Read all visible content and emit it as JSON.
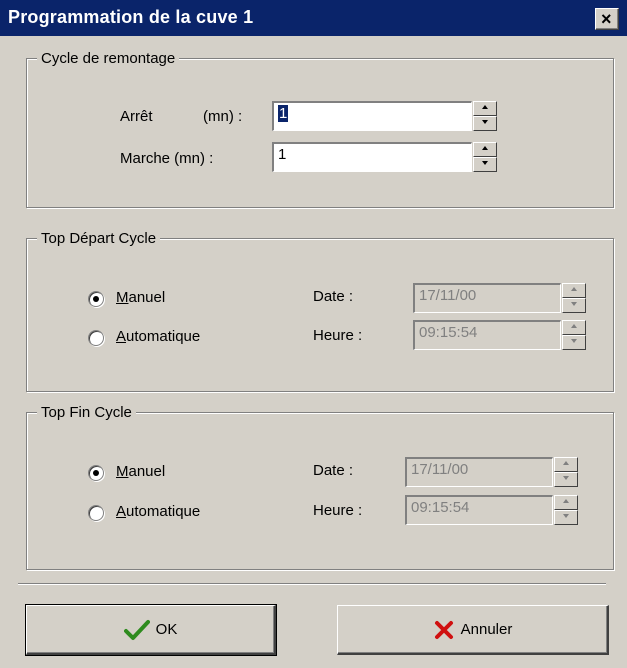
{
  "window": {
    "title": "Programmation de la cuve 1",
    "close_glyph": "×"
  },
  "cycle_remontage": {
    "legend": "Cycle de remontage",
    "arret_label": "Arrêt",
    "arret_unit": "(mn) :",
    "arret_value": "1",
    "marche_label": "Marche (mn) :",
    "marche_value": "1"
  },
  "top_depart": {
    "legend": "Top Départ Cycle",
    "manuel_label_u": "M",
    "manuel_label_rest": "anuel",
    "auto_label_u": "A",
    "auto_label_rest": "utomatique",
    "selected": "manuel",
    "date_label": "Date :",
    "date_value": "17/11/00",
    "heure_label": "Heure :",
    "heure_value": "09:15:54"
  },
  "top_fin": {
    "legend": "Top Fin Cycle",
    "manuel_label_u": "M",
    "manuel_label_rest": "anuel",
    "auto_label_u": "A",
    "auto_label_rest": "utomatique",
    "selected": "manuel",
    "date_label": "Date :",
    "date_value": "17/11/00",
    "heure_label": "Heure :",
    "heure_value": "09:15:54"
  },
  "buttons": {
    "ok_label": "OK",
    "ok_icon": "checkmark-icon",
    "ok_icon_color": "#2e8b1e",
    "cancel_label": "Annuler",
    "cancel_icon": "x-icon",
    "cancel_icon_color": "#d01010"
  },
  "colors": {
    "titlebar": "#0a246a",
    "face": "#d4d0c8"
  }
}
